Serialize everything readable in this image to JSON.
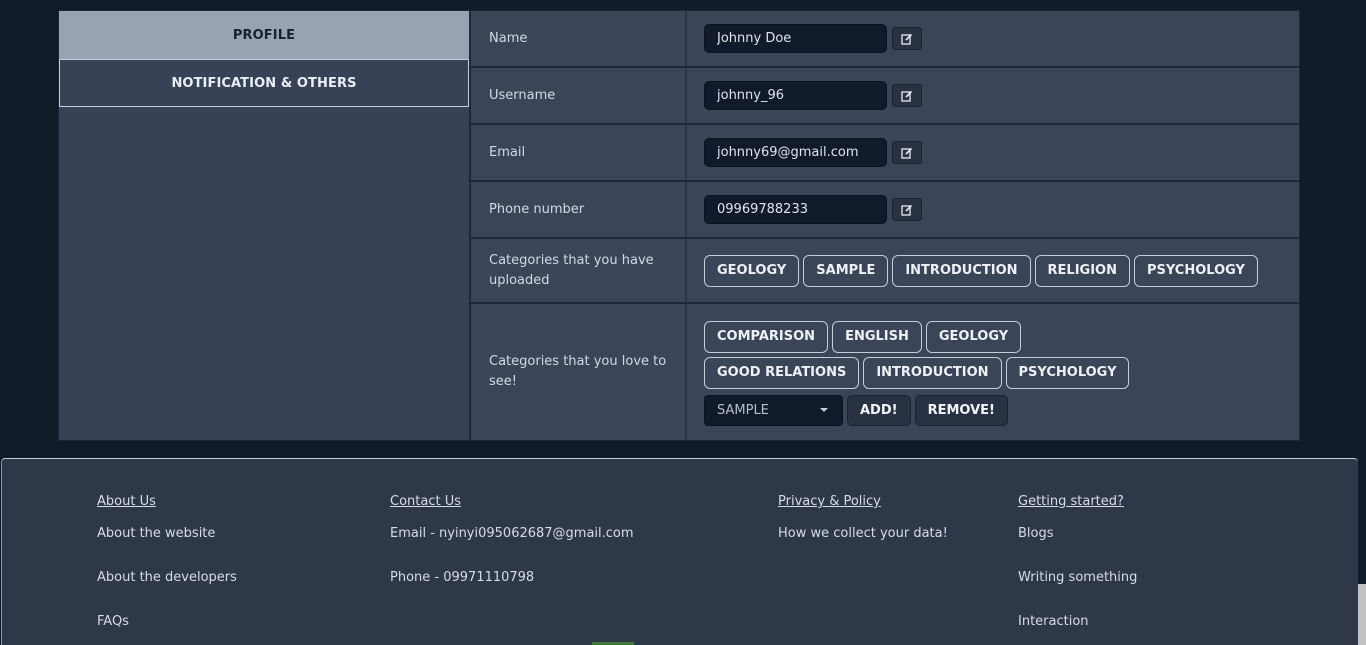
{
  "sidebar": {
    "tabs": [
      {
        "label": "PROFILE"
      },
      {
        "label": "NOTIFICATION & OTHERS"
      }
    ]
  },
  "profile": {
    "name": {
      "label": "Name",
      "value": "Johnny Doe"
    },
    "username": {
      "label": "Username",
      "value": "johnny_96"
    },
    "email": {
      "label": "Email",
      "value": "johnny69@gmail.com"
    },
    "phone": {
      "label": "Phone number",
      "value": "09969788233"
    },
    "uploaded": {
      "label": "Categories that you have uploaded",
      "chips": [
        "GEOLOGY",
        "SAMPLE",
        "INTRODUCTION",
        "RELIGION",
        "PSYCHOLOGY"
      ]
    },
    "loved": {
      "label": "Categories that you love to see!",
      "chips": [
        "COMPARISON",
        "ENGLISH",
        "GEOLOGY",
        "GOOD RELATIONS",
        "INTRODUCTION",
        "PSYCHOLOGY"
      ],
      "select_value": "SAMPLE",
      "add_label": "ADD!",
      "remove_label": "REMOVE!"
    }
  },
  "footer": {
    "about": {
      "heading": "About Us",
      "links": [
        "About the website",
        "About the developers",
        "FAQs"
      ]
    },
    "contact": {
      "heading": "Contact Us",
      "lines": [
        "Email - nyinyi095062687@gmail.com",
        "Phone - 09971110798"
      ]
    },
    "privacy": {
      "heading": "Privacy & Policy",
      "links": [
        "How we collect your data!"
      ]
    },
    "started": {
      "heading": "Getting started?",
      "links": [
        "Blogs",
        "Writing something",
        "Interaction"
      ]
    }
  },
  "icons": {
    "edit": "edit-icon",
    "dropdown": "chevron-down-icon"
  },
  "colors": {
    "background": "#111a27",
    "panel": "#3a4558",
    "active_tab": "#98a2b1",
    "input": "#111a2b"
  }
}
